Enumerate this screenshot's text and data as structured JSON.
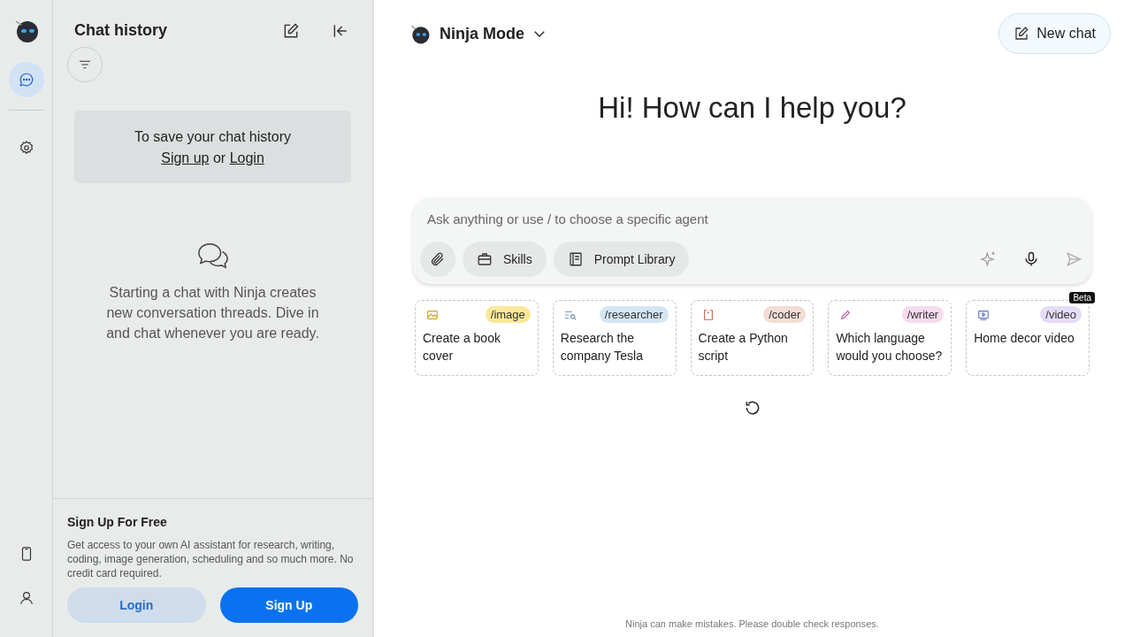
{
  "rail": {
    "items": [
      {
        "kind": "chat",
        "selected": true
      },
      {
        "kind": "settings",
        "selected": false
      }
    ],
    "bottom": [
      {
        "kind": "phone"
      },
      {
        "kind": "user"
      }
    ]
  },
  "sidebar": {
    "title": "Chat history",
    "save_notice": {
      "text": "To save your chat history",
      "signup_link": "Sign up",
      "joiner": "or",
      "login_link": "Login"
    },
    "empty_state": "Starting a chat with Ninja creates new conversation threads. Dive in and chat whenever you are ready.",
    "promo": {
      "title": "Sign Up For Free",
      "body": "Get access to your own AI assistant for research, writing, coding, image generation, scheduling and so much more. No credit card required.",
      "buttons": [
        {
          "label": "Login",
          "kind": "secondary"
        },
        {
          "label": "Sign Up",
          "kind": "primary"
        }
      ]
    }
  },
  "header": {
    "mode": "Ninja Mode",
    "new_chat": "New chat"
  },
  "greeting": "Hi! How can I help you?",
  "composer": {
    "placeholder": "Ask anything or use / to choose a specific agent",
    "tools": [
      {
        "kind": "attach"
      },
      {
        "kind": "skills",
        "label": "Skills"
      },
      {
        "kind": "library",
        "label": "Prompt Library"
      }
    ]
  },
  "agents": [
    {
      "kind": "image",
      "tag": "/image",
      "color": "#fbe89a",
      "text": "Create a book cover"
    },
    {
      "kind": "researcher",
      "tag": "/researcher",
      "color": "#d4e6f4",
      "text": "Research the company Tesla"
    },
    {
      "kind": "coder",
      "tag": "/coder",
      "color": "#f3ddd4",
      "text": "Create a Python script"
    },
    {
      "kind": "writer",
      "tag": "/writer",
      "color": "#f5dcef",
      "text": "Which language would you choose?"
    },
    {
      "kind": "video",
      "tag": "/video",
      "color": "#e6dcf7",
      "text": "Home decor video",
      "badge": "Beta"
    }
  ],
  "footer": "Ninja can make mistakes. Please double check responses."
}
